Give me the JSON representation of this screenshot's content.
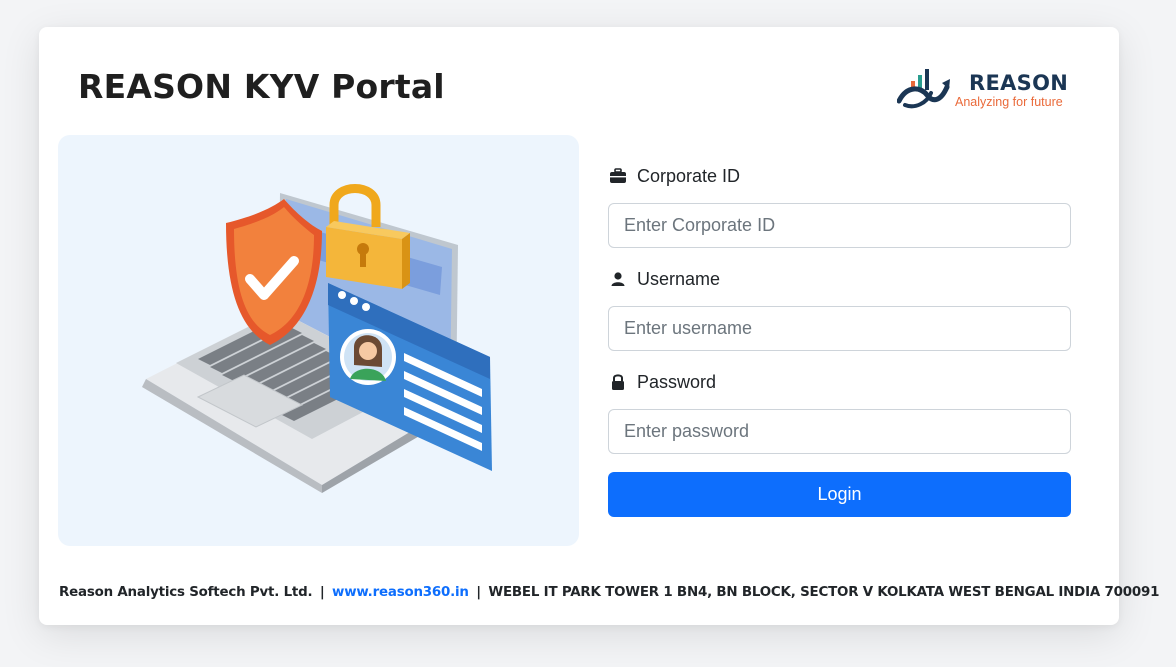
{
  "header": {
    "title": "REASON KYV Portal"
  },
  "brand": {
    "name": "REASON",
    "tagline": "Analyzing for future",
    "colors": {
      "navy": "#1b3654",
      "orange": "#ea6a3a",
      "teal": "#2a9d8f"
    }
  },
  "illustration": {
    "icons": [
      "laptop-icon",
      "shield-check-icon",
      "padlock-icon",
      "id-card-icon"
    ]
  },
  "form": {
    "corporate_id": {
      "label": "Corporate ID",
      "icon": "briefcase-icon",
      "placeholder": "Enter Corporate ID",
      "value": ""
    },
    "username": {
      "label": "Username",
      "icon": "user-icon",
      "placeholder": "Enter username",
      "value": ""
    },
    "password": {
      "label": "Password",
      "icon": "lock-icon",
      "placeholder": "Enter password",
      "value": ""
    },
    "login_label": "Login"
  },
  "footer": {
    "company": "Reason Analytics Softech Pvt. Ltd.",
    "separator": "|",
    "website": "www.reason360.in",
    "address": "WEBEL IT PARK TOWER 1 BN4, BN BLOCK, SECTOR V KOLKATA WEST BENGAL INDIA 700091"
  },
  "colors": {
    "primary": "#0d6efd",
    "page_bg": "#f3f4f6",
    "panel_bg": "#edf5fd"
  }
}
